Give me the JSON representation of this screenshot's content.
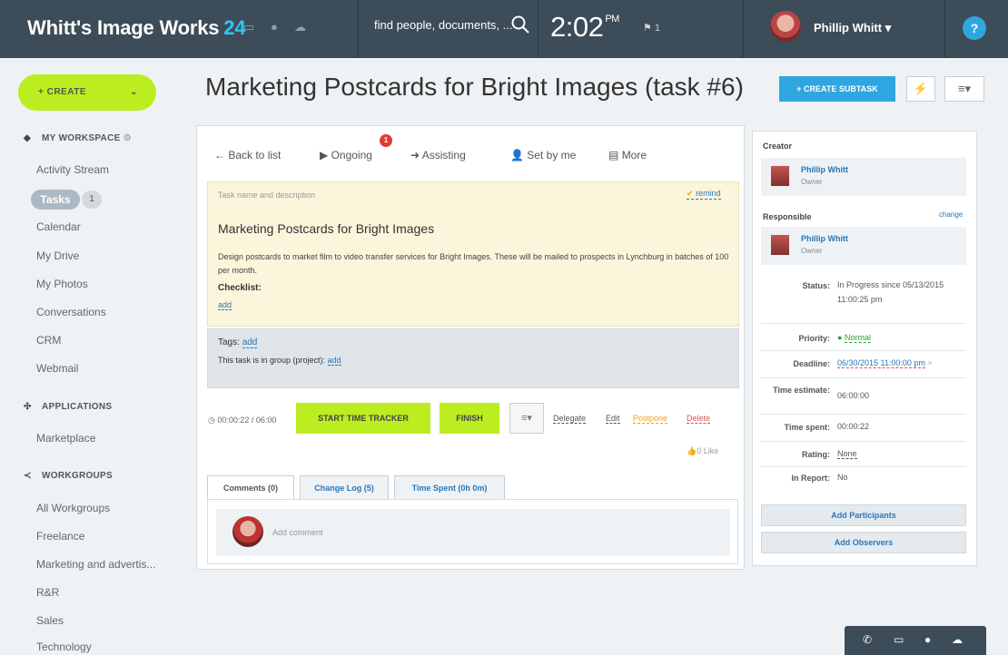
{
  "header": {
    "brand": "Whitt's Image Works",
    "brand_suffix": "24",
    "search_placeholder": "find people, documents, ...",
    "time": "2:02",
    "time_suffix": "PM",
    "flag_count": "1",
    "user_name": "Phillip Whitt",
    "help": "?"
  },
  "sidebar": {
    "create_label": "+ CREATE",
    "workspace_heading": "MY WORKSPACE",
    "workspace_items": [
      "Activity Stream",
      "Tasks",
      "Calendar",
      "My Drive",
      "My Photos",
      "Conversations",
      "CRM",
      "Webmail"
    ],
    "tasks_count": "1",
    "applications_heading": "APPLICATIONS",
    "applications_items": [
      "Marketplace"
    ],
    "workgroups_heading": "WORKGROUPS",
    "workgroups_items": [
      "All Workgroups",
      "Freelance",
      "Marketing and advertis...",
      "R&R",
      "Sales",
      "Technology"
    ]
  },
  "task": {
    "page_title": "Marketing Postcards for Bright Images (task #6)",
    "create_subtask": "+ CREATE SUBTASK",
    "toolbar": {
      "back": "← Back to list",
      "ongoing": "Ongoing",
      "ongoing_badge": "1",
      "assisting": "Assisting",
      "set_by_me": "Set by me",
      "more": "More"
    },
    "desc_label": "Task name and description",
    "remind": "remind",
    "name": "Marketing Postcards for Bright Images",
    "description": "Design postcards to market film to video transfer services for Bright Images. These will be mailed to prospects in Lynchburg in batches of 100 per month.",
    "checklist_label": "Checklist:",
    "checklist_add": "add",
    "tags_label": "Tags:",
    "tags_add": "add",
    "group_label": "This task is in group (project):",
    "group_add": "add",
    "timer": "00:00:22 / 06:00",
    "start_tracker": "START TIME TRACKER",
    "finish": "FINISH",
    "actions": {
      "delegate": "Delegate",
      "edit": "Edit",
      "postpone": "Postpone",
      "delete": "Delete"
    },
    "like": "0 Like",
    "tabs": [
      "Comments (0)",
      "Change Log (5)",
      "Time Spent (0h 0m)"
    ],
    "comment_placeholder": "Add comment"
  },
  "details": {
    "creator_label": "Creator",
    "creator_name": "Phillip Whitt",
    "creator_role": "Owner",
    "responsible_label": "Responsible",
    "change": "change",
    "responsible_name": "Phillip Whitt",
    "responsible_role": "Owner",
    "fields": [
      {
        "label": "Status:",
        "value": "In Progress since 05/13/2015 11:00:25 pm"
      },
      {
        "label": "Priority:",
        "value": "Normal"
      },
      {
        "label": "Deadline:",
        "value": "06/30/2015 11:00:00 pm"
      },
      {
        "label": "Time estimate:",
        "value": "06:00:00"
      },
      {
        "label": "Time spent:",
        "value": "00:00:22"
      },
      {
        "label": "Rating:",
        "value": "None"
      },
      {
        "label": "In Report:",
        "value": "No"
      }
    ],
    "add_participants": "Add Participants",
    "add_observers": "Add Observers"
  },
  "colors": {
    "accent_green": "#bbed21",
    "accent_blue": "#2fa6e0",
    "header_bg": "#3c4c58",
    "priority_green": "#2aa52a",
    "delete_red": "#d9534f",
    "postpone_orange": "#e8a12b"
  }
}
